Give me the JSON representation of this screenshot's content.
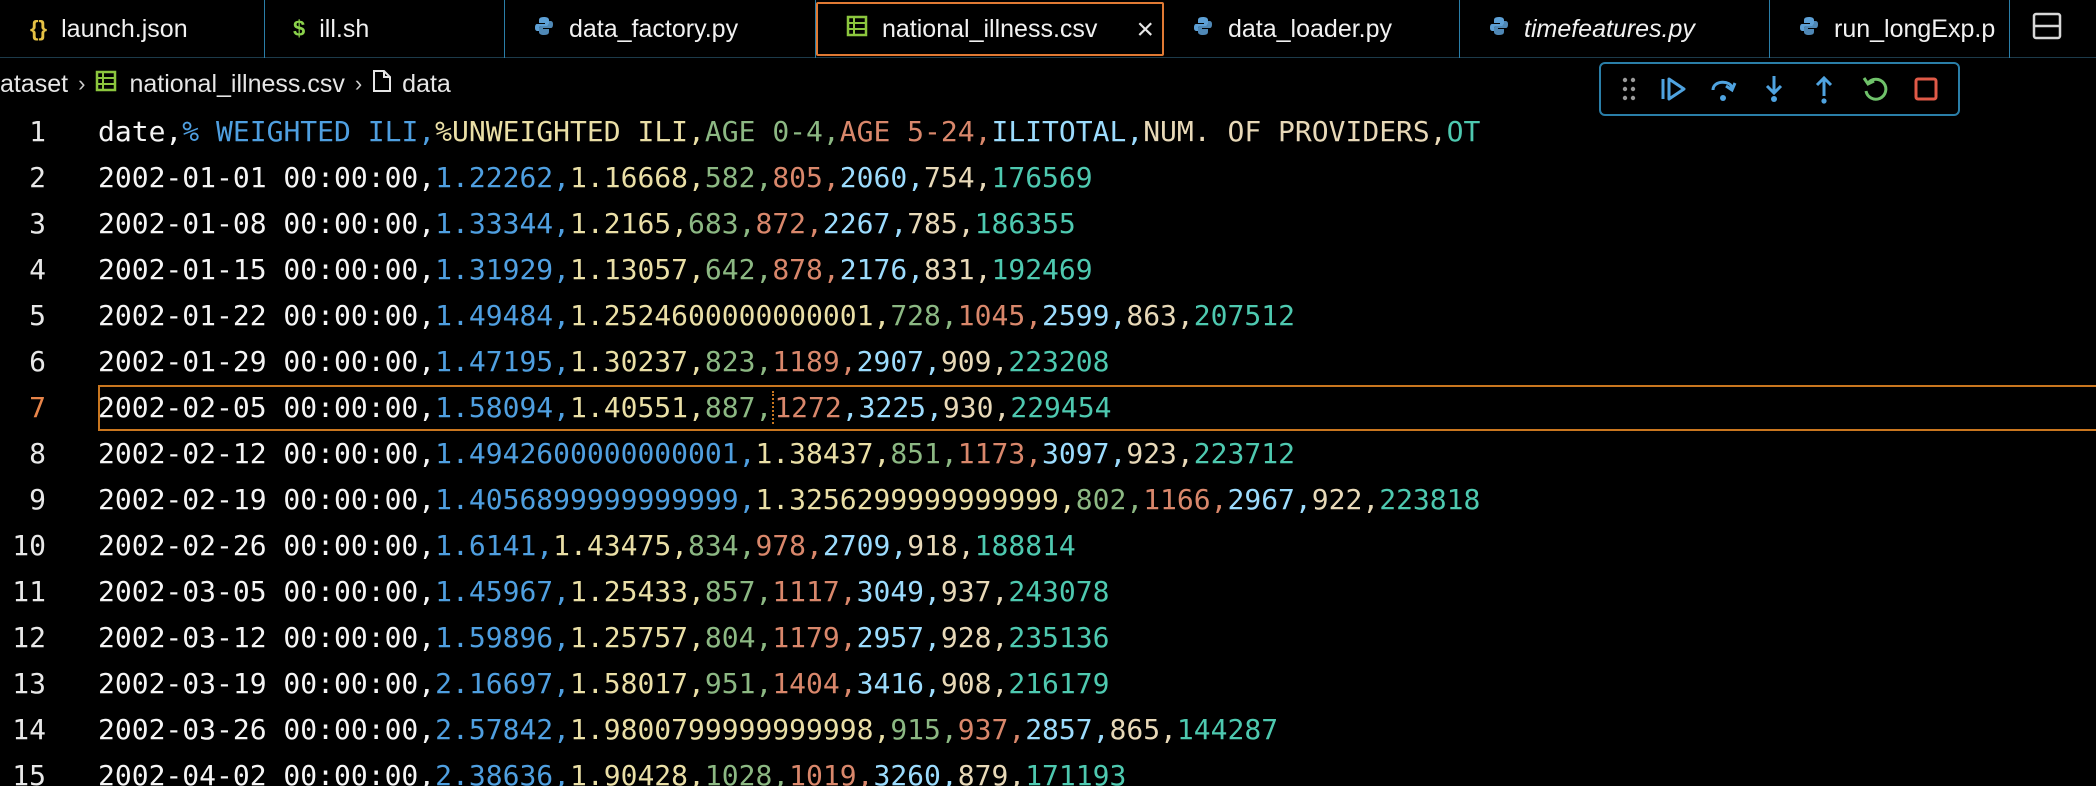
{
  "tabs": [
    {
      "label": "launch.json",
      "icon": "json-icon",
      "icon_glyph": "{}",
      "icon_color": "#e6c245",
      "width": 265,
      "active": false,
      "italic": false
    },
    {
      "label": "ill.sh",
      "icon": "shell-icon",
      "icon_glyph": "$",
      "icon_color": "#8bd24b",
      "width": 240,
      "active": false,
      "italic": false
    },
    {
      "label": "data_factory.py",
      "icon": "python-icon",
      "icon_glyph": "",
      "icon_color": "#5da0d6",
      "width": 311,
      "active": false,
      "italic": false
    },
    {
      "label": "national_illness.csv",
      "icon": "csv-icon",
      "icon_glyph": "",
      "icon_color": "#8cc63e",
      "width": 348,
      "active": true,
      "italic": false
    },
    {
      "label": "data_loader.py",
      "icon": "python-icon",
      "icon_glyph": "",
      "icon_color": "#5da0d6",
      "width": 296,
      "active": false,
      "italic": false
    },
    {
      "label": "timefeatures.py",
      "icon": "python-icon",
      "icon_glyph": "",
      "icon_color": "#5da0d6",
      "width": 310,
      "active": false,
      "italic": true
    },
    {
      "label": "run_longExp.p",
      "icon": "python-icon",
      "icon_glyph": "",
      "icon_color": "#5da0d6",
      "width": 240,
      "active": false,
      "italic": false
    }
  ],
  "breadcrumb": {
    "folder": "ataset",
    "file": "national_illness.csv",
    "symbol": "data"
  },
  "colors": {
    "accent_orange": "#e07a34",
    "border_blue": "#2a7ea8",
    "debug_blue": "#4fa3e0",
    "debug_green": "#6fc26a",
    "debug_red": "#e05a48"
  },
  "editor": {
    "current_line": 7,
    "lines": [
      {
        "n": "1",
        "segs": [
          "date,",
          "% WEIGHTED ILI,",
          "%UNWEIGHTED ILI,",
          "AGE 0-4,",
          "AGE 5-24,",
          "ILITOTAL,",
          "NUM. OF PROVIDERS,",
          "OT"
        ]
      },
      {
        "n": "2",
        "segs": [
          "2002-01-01 00:00:00,",
          "1.22262,",
          "1.16668,",
          "582,",
          "805,",
          "2060,",
          "754,",
          "176569"
        ]
      },
      {
        "n": "3",
        "segs": [
          "2002-01-08 00:00:00,",
          "1.33344,",
          "1.2165,",
          "683,",
          "872,",
          "2267,",
          "785,",
          "186355"
        ]
      },
      {
        "n": "4",
        "segs": [
          "2002-01-15 00:00:00,",
          "1.31929,",
          "1.13057,",
          "642,",
          "878,",
          "2176,",
          "831,",
          "192469"
        ]
      },
      {
        "n": "5",
        "segs": [
          "2002-01-22 00:00:00,",
          "1.49484,",
          "1.2524600000000001,",
          "728,",
          "1045,",
          "2599,",
          "863,",
          "207512"
        ]
      },
      {
        "n": "6",
        "segs": [
          "2002-01-29 00:00:00,",
          "1.47195,",
          "1.30237,",
          "823,",
          "1189,",
          "2907,",
          "909,",
          "223208"
        ]
      },
      {
        "n": "7",
        "segs": [
          "2002-02-05 00:00:00,",
          "1.58094,",
          "1.40551,",
          "887,",
          "1272",
          ",3225,",
          "930,",
          "229454"
        ]
      },
      {
        "n": "8",
        "segs": [
          "2002-02-12 00:00:00,",
          "1.4942600000000001,",
          "1.38437,",
          "851,",
          "1173,",
          "3097,",
          "923,",
          "223712"
        ]
      },
      {
        "n": "9",
        "segs": [
          "2002-02-19 00:00:00,",
          "1.4056899999999999,",
          "1.3256299999999999,",
          "802,",
          "1166,",
          "2967,",
          "922,",
          "223818"
        ]
      },
      {
        "n": "10",
        "segs": [
          "2002-02-26 00:00:00,",
          "1.6141,",
          "1.43475,",
          "834,",
          "978,",
          "2709,",
          "918,",
          "188814"
        ]
      },
      {
        "n": "11",
        "segs": [
          "2002-03-05 00:00:00,",
          "1.45967,",
          "1.25433,",
          "857,",
          "1117,",
          "3049,",
          "937,",
          "243078"
        ]
      },
      {
        "n": "12",
        "segs": [
          "2002-03-12 00:00:00,",
          "1.59896,",
          "1.25757,",
          "804,",
          "1179,",
          "2957,",
          "928,",
          "235136"
        ]
      },
      {
        "n": "13",
        "segs": [
          "2002-03-19 00:00:00,",
          "2.16697,",
          "1.58017,",
          "951,",
          "1404,",
          "3416,",
          "908,",
          "216179"
        ]
      },
      {
        "n": "14",
        "segs": [
          "2002-03-26 00:00:00,",
          "2.57842,",
          "1.9800799999999998,",
          "915,",
          "937,",
          "2857,",
          "865,",
          "144287"
        ]
      },
      {
        "n": "15",
        "segs": [
          "2002-04-02 00:00:00,",
          "2.38636,",
          "1.90428,",
          "1028,",
          "1019,",
          "3260,",
          "879,",
          "171193"
        ]
      }
    ]
  }
}
